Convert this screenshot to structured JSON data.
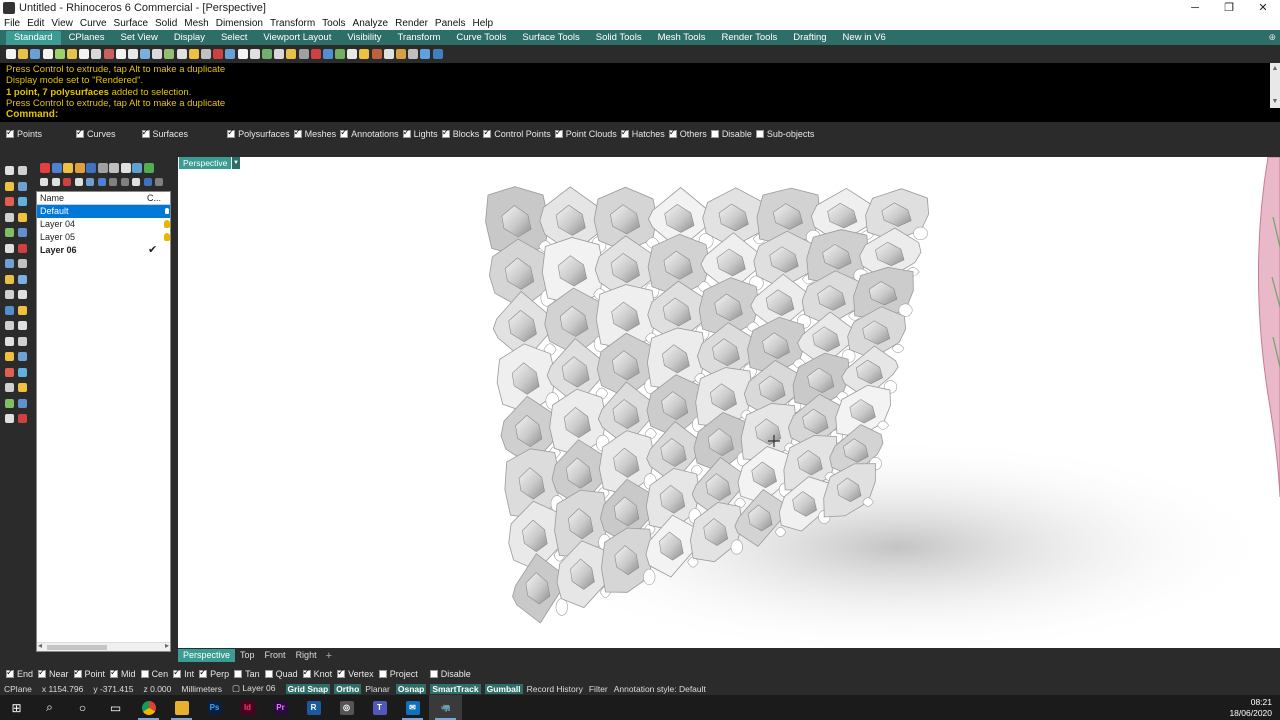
{
  "window": {
    "title": "Untitled - Rhinoceros 6 Commercial - [Perspective]",
    "controls": [
      "─",
      "❐",
      "✕"
    ]
  },
  "menubar": [
    "File",
    "Edit",
    "View",
    "Curve",
    "Surface",
    "Solid",
    "Mesh",
    "Dimension",
    "Transform",
    "Tools",
    "Analyze",
    "Render",
    "Panels",
    "Help"
  ],
  "tabs": [
    "Standard",
    "CPlanes",
    "Set View",
    "Display",
    "Select",
    "Viewport Layout",
    "Visibility",
    "Transform",
    "Curve Tools",
    "Surface Tools",
    "Solid Tools",
    "Mesh Tools",
    "Render Tools",
    "Drafting",
    "New in V6"
  ],
  "active_tab": "Standard",
  "command_history": [
    "Press Control to extrude, tap Alt to make a duplicate",
    "Display mode set to \"Rendered\".",
    "1 point, 7 polysurfaces added to selection.",
    "Press Control to extrude, tap Alt to make a duplicate"
  ],
  "command_history_bold": "1 point, 7 polysurfaces",
  "command_history_rest": " added to selection.",
  "command_prompt": "Command:",
  "select_filter": [
    {
      "label": "Points",
      "checked": true
    },
    {
      "label": "Curves",
      "checked": true
    },
    {
      "label": "Surfaces",
      "checked": true
    },
    {
      "label": "Polysurfaces",
      "checked": true
    },
    {
      "label": "Meshes",
      "checked": true
    },
    {
      "label": "Annotations",
      "checked": true
    },
    {
      "label": "Lights",
      "checked": true
    },
    {
      "label": "Blocks",
      "checked": true
    },
    {
      "label": "Control Points",
      "checked": true
    },
    {
      "label": "Point Clouds",
      "checked": true
    },
    {
      "label": "Hatches",
      "checked": true
    },
    {
      "label": "Others",
      "checked": true
    },
    {
      "label": "Disable",
      "checked": false
    },
    {
      "label": "Sub-objects",
      "checked": false
    }
  ],
  "layers": {
    "header_name": "Name",
    "header_color": "C...",
    "rows": [
      {
        "name": "Default",
        "selected": true,
        "current": false
      },
      {
        "name": "Layer 04",
        "selected": false,
        "current": false
      },
      {
        "name": "Layer 05",
        "selected": false,
        "current": false
      },
      {
        "name": "Layer 06",
        "selected": false,
        "current": true
      }
    ]
  },
  "viewport": {
    "title": "Perspective",
    "tabs": [
      "Perspective",
      "Top",
      "Front",
      "Right"
    ],
    "add_tab": "+"
  },
  "osnaps": [
    {
      "label": "End",
      "checked": true
    },
    {
      "label": "Near",
      "checked": true
    },
    {
      "label": "Point",
      "checked": true
    },
    {
      "label": "Mid",
      "checked": true
    },
    {
      "label": "Cen",
      "checked": false
    },
    {
      "label": "Int",
      "checked": true
    },
    {
      "label": "Perp",
      "checked": true
    },
    {
      "label": "Tan",
      "checked": false
    },
    {
      "label": "Quad",
      "checked": false
    },
    {
      "label": "Knot",
      "checked": true
    },
    {
      "label": "Vertex",
      "checked": true
    },
    {
      "label": "Project",
      "checked": false
    },
    {
      "label": "Disable",
      "checked": false
    }
  ],
  "status": {
    "cplane": "CPlane",
    "x": "x 1154.796",
    "y": "y -371.415",
    "z": "z 0.000",
    "units": "Millimeters",
    "layer": "Layer 06",
    "toggles_on": [
      "Grid Snap",
      "Ortho"
    ],
    "planar": "Planar",
    "toggles_on2": [
      "Osnap",
      "SmartTrack",
      "Gumball"
    ],
    "record_history": "Record History",
    "filter": "Filter",
    "annotation_style": "Annotation style: Default"
  },
  "taskbar": {
    "apps": [
      {
        "name": "start",
        "glyph": "⊞"
      },
      {
        "name": "search",
        "glyph": "⌕"
      },
      {
        "name": "cortana",
        "glyph": "○"
      },
      {
        "name": "task-view",
        "glyph": "▭"
      },
      {
        "name": "chrome",
        "glyph": ""
      },
      {
        "name": "file-explorer",
        "glyph": ""
      },
      {
        "name": "photoshop",
        "glyph": "Ps"
      },
      {
        "name": "indesign",
        "glyph": "Id"
      },
      {
        "name": "premiere",
        "glyph": "Pr"
      },
      {
        "name": "revit",
        "glyph": "R"
      },
      {
        "name": "app-circle",
        "glyph": "◎"
      },
      {
        "name": "teams",
        "glyph": "T"
      },
      {
        "name": "mail",
        "glyph": "✉"
      },
      {
        "name": "rhino",
        "glyph": "🦏"
      }
    ],
    "time": "08:21",
    "date": "18/06/2020"
  },
  "colors": {
    "accent": "#3a9c92",
    "accent_dark": "#2d6e68",
    "command_text": "#e5c300",
    "selection": "#0078d7"
  }
}
